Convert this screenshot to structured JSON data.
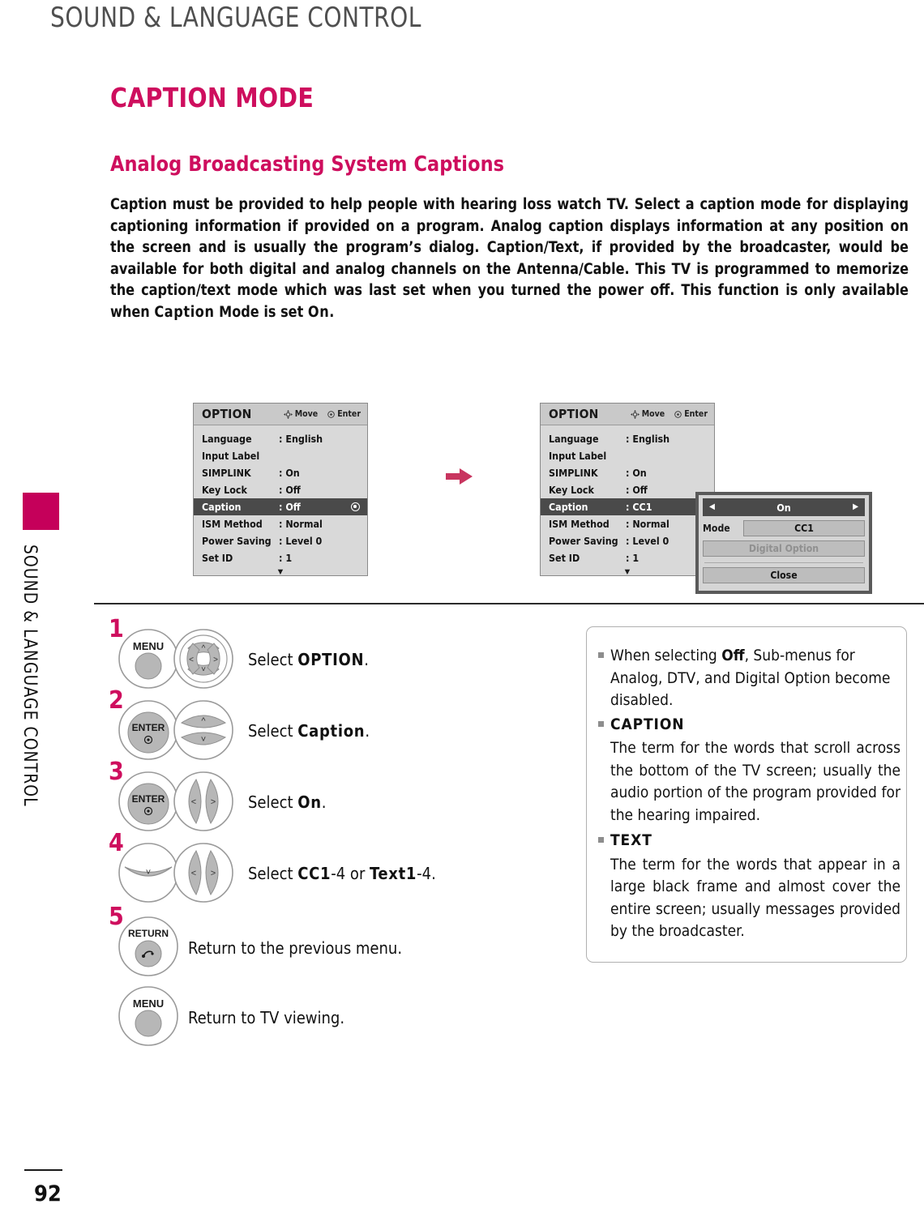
{
  "running_head": "SOUND & LANGUAGE CONTROL",
  "side_tab": {
    "label": "SOUND & LANGUAGE CONTROL",
    "block_color": "#c5005a"
  },
  "colors": {
    "accent_pink": "#ce0e5e",
    "osd_body": "#d9d9d9",
    "osd_header": "#c9c9c9",
    "osd_selected": "#4a4a4a"
  },
  "headings": {
    "h1": "CAPTION MODE",
    "h2": "Analog Broadcasting System Captions"
  },
  "intro": {
    "part1": "Caption must be provided to help people with hearing loss watch TV. Select a caption mode for displaying captioning information if provided on a program. Analog caption displays information at any position on the screen and is usually the program’s dialog. Caption/Text, if provided by the broadcaster, would be available for both digital and analog channels on the Antenna/Cable. This TV is programmed to memorize the caption/text mode which was last set when you turned the power off. This function is only available when ",
    "emph1": "Caption",
    "part2": " Mode is set ",
    "emph2": "On",
    "part3": "."
  },
  "osd": {
    "title": "OPTION",
    "hint_move": "Move",
    "hint_enter": "Enter",
    "scroll_down_glyph": "▼",
    "left": {
      "rows": [
        {
          "label": "Language",
          "value": ": English"
        },
        {
          "label": "Input Label",
          "value": ""
        },
        {
          "label": "SIMPLINK",
          "value": ": On"
        },
        {
          "label": "Key Lock",
          "value": ": Off"
        },
        {
          "label": "Caption",
          "value": ": Off",
          "selected": true,
          "has_dot": true
        },
        {
          "label": "ISM Method",
          "value": ": Normal"
        },
        {
          "label": "Power Saving",
          "value": ": Level 0"
        },
        {
          "label": "Set ID",
          "value": ": 1"
        }
      ]
    },
    "right": {
      "rows": [
        {
          "label": "Language",
          "value": ": English"
        },
        {
          "label": "Input Label",
          "value": ""
        },
        {
          "label": "SIMPLINK",
          "value": ": On"
        },
        {
          "label": "Key Lock",
          "value": ": Off"
        },
        {
          "label": "Caption",
          "value": ": CC1",
          "selected": true
        },
        {
          "label": "ISM Method",
          "value": ": Normal"
        },
        {
          "label": "Power Saving",
          "value": ": Level 0"
        },
        {
          "label": "Set ID",
          "value": ": 1"
        }
      ]
    }
  },
  "popup": {
    "left_arrow": "◀",
    "value": "On",
    "right_arrow": "▶",
    "mode_label": "Mode",
    "mode_value": "CC1",
    "digital_option": "Digital Option",
    "close": "Close"
  },
  "steps": [
    {
      "num": "1",
      "keys": [
        "MENU",
        "4way"
      ],
      "text_pre": "Select ",
      "text_bold": "OPTION",
      "text_post": "."
    },
    {
      "num": "2",
      "keys": [
        "ENTER",
        "updown"
      ],
      "text_pre": "Select ",
      "text_bold": "Caption",
      "text_post": "."
    },
    {
      "num": "3",
      "keys": [
        "ENTER",
        "leftright"
      ],
      "text_pre": "Select ",
      "text_bold": "On",
      "text_post": "."
    },
    {
      "num": "4",
      "keys": [
        "down",
        "leftright"
      ],
      "text_pre": "Select ",
      "text_bold": "CC1",
      "text_mid": "-4",
      "text_or": " or ",
      "text_bold2": "Text1",
      "text_mid2": "-4",
      "text_post": "."
    },
    {
      "num": "5",
      "keys": [
        "RETURN"
      ],
      "text_pre": "Return to the previous menu.",
      "text_bold": "",
      "text_post": ""
    },
    {
      "num": "",
      "keys": [
        "MENU"
      ],
      "text_pre": "Return to TV viewing.",
      "text_bold": "",
      "text_post": ""
    }
  ],
  "key_labels": {
    "menu": "MENU",
    "enter": "ENTER",
    "return": "RETURN"
  },
  "notes": [
    {
      "type": "paragraph",
      "pre": "When selecting ",
      "bold": "Off",
      "post": ", Sub-menus for Analog, DTV, and Digital Option become disabled."
    },
    {
      "type": "heading",
      "text": "CAPTION"
    },
    {
      "type": "body",
      "text": "The term for the words that scroll across the bottom of the TV screen; usually the audio portion of the program provided for the hearing impaired."
    },
    {
      "type": "heading",
      "text": "TEXT"
    },
    {
      "type": "body",
      "text": "The term for the words that appear in a large black frame and almost cover the entire screen; usually messages provided by the broadcaster."
    }
  ],
  "footer": {
    "page_number": "92"
  }
}
